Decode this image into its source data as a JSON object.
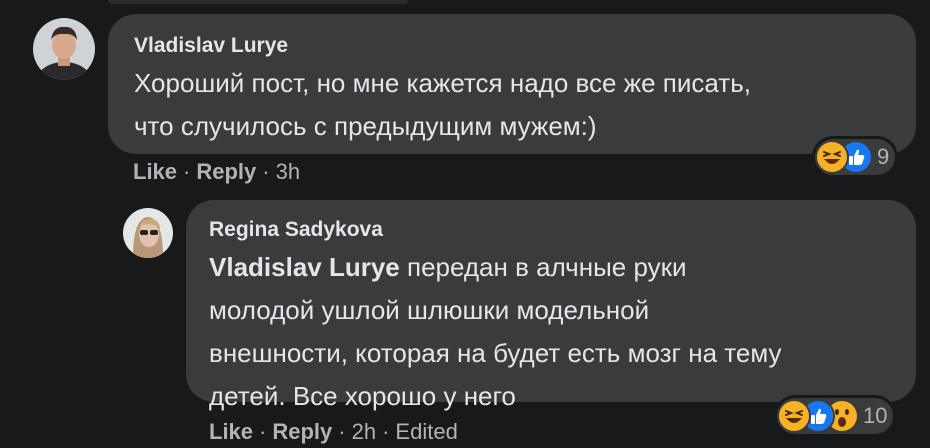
{
  "comments": [
    {
      "author": "Vladislav Lurye",
      "text_lines": [
        "Хороший пост, но мне кажется надо все же писать,",
        "что случилось с предыдущим мужем:)"
      ],
      "like_label": "Like",
      "reply_label": "Reply",
      "time": "3h",
      "reaction_count": "9",
      "reaction_icons": [
        "haha-icon",
        "like-icon"
      ]
    },
    {
      "author": "Regina Sadykova",
      "mention": "Vladislav Lurye",
      "text_first_rest": " передан в алчные руки",
      "text_lines": [
        "молодой ушлой шлюшки модельной",
        "внешности, которая на будет есть мозг на тему",
        "детей. Все хорошо у него"
      ],
      "like_label": "Like",
      "reply_label": "Reply",
      "time": "2h",
      "edited_label": "Edited",
      "reaction_count": "10",
      "reaction_icons": [
        "haha-icon",
        "like-icon",
        "wow-icon"
      ]
    }
  ],
  "separator": "·",
  "colors": {
    "background": "#18191a",
    "bubble": "#3a3b3c",
    "text_primary": "#e4e6eb",
    "text_secondary": "#b0b3b8",
    "like_blue": "#1877f2",
    "emoji_yellow": "#f7b125"
  }
}
